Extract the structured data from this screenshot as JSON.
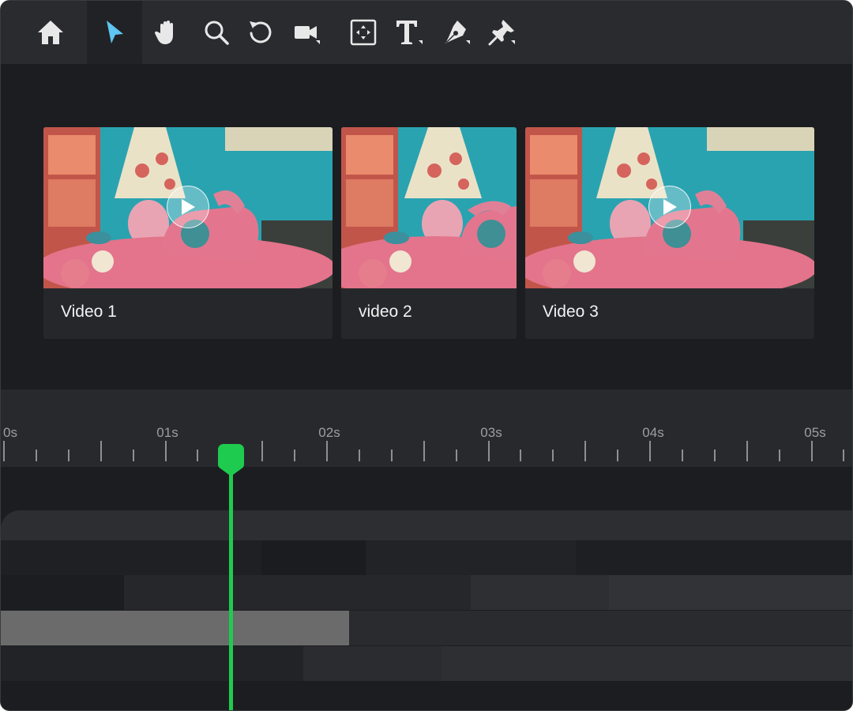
{
  "toolbar": {
    "tools": [
      {
        "icon": "home-icon",
        "active": false
      },
      {
        "icon": "cursor-icon",
        "active": true
      },
      {
        "icon": "hand-icon",
        "active": false
      },
      {
        "icon": "zoom-icon",
        "active": false
      },
      {
        "icon": "rotate-icon",
        "active": false
      },
      {
        "icon": "camera-icon",
        "active": false
      },
      {
        "icon": "fit-frame-icon",
        "active": false
      },
      {
        "icon": "text-icon",
        "active": false
      },
      {
        "icon": "pen-icon",
        "active": false
      },
      {
        "icon": "pin-icon",
        "active": false
      }
    ],
    "active_color": "#5ec6f0"
  },
  "videos": [
    {
      "title": "Video 1"
    },
    {
      "title": "video 2"
    },
    {
      "title": "Video 3"
    }
  ],
  "timeline": {
    "ruler_labels": [
      "0s",
      "01s",
      "02s",
      "03s",
      "04s",
      "05s"
    ],
    "playhead_color": "#1ecb4f"
  }
}
